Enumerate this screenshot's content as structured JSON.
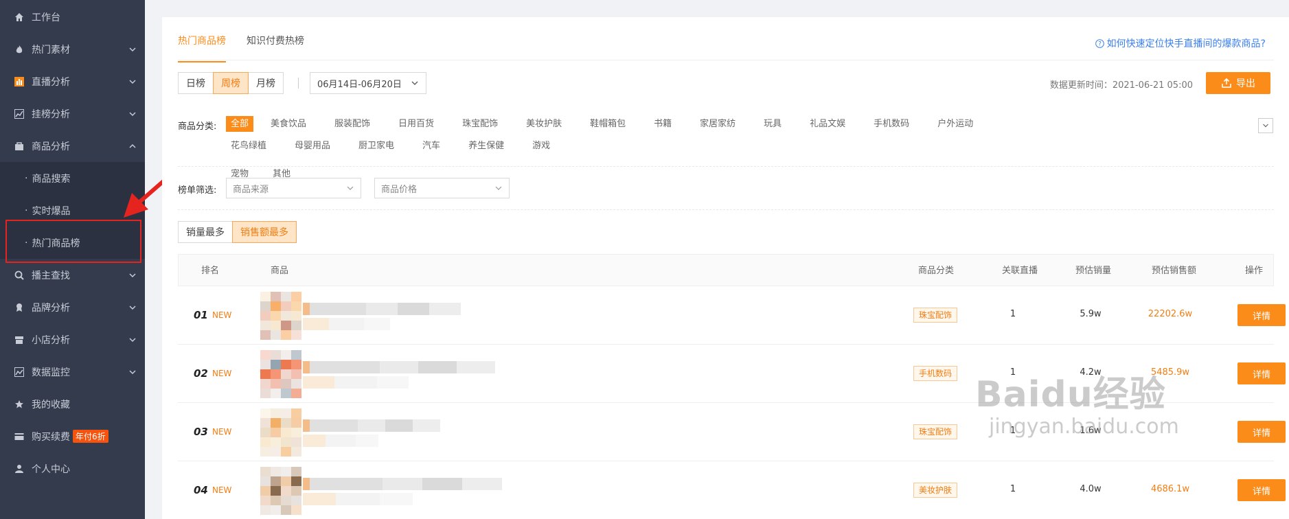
{
  "sidebar": {
    "items": [
      {
        "label": "工作台",
        "icon": "home-icon",
        "chevron": false
      },
      {
        "label": "热门素材",
        "icon": "fire-icon",
        "chevron": true
      },
      {
        "label": "直播分析",
        "icon": "bar-chart-icon",
        "chevron": true
      },
      {
        "label": "挂榜分析",
        "icon": "line-chart-icon",
        "chevron": true
      },
      {
        "label": "商品分析",
        "icon": "bag-icon",
        "chevron": true,
        "expanded": true
      }
    ],
    "sub_items": [
      "商品搜索",
      "实时爆品",
      "热门商品榜"
    ],
    "items_after": [
      {
        "label": "播主查找",
        "icon": "search-icon",
        "chevron": true
      },
      {
        "label": "品牌分析",
        "icon": "medal-icon",
        "chevron": true
      },
      {
        "label": "小店分析",
        "icon": "shop-icon",
        "chevron": true
      },
      {
        "label": "数据监控",
        "icon": "monitor-icon",
        "chevron": true
      },
      {
        "label": "我的收藏",
        "icon": "star-icon",
        "chevron": false
      },
      {
        "label": "购买续费",
        "icon": "card-icon",
        "chevron": false,
        "badge": "年付6折"
      },
      {
        "label": "个人中心",
        "icon": "user-icon",
        "chevron": false
      }
    ],
    "sub_dot": "·"
  },
  "tabs": [
    "热门商品榜",
    "知识付费热榜"
  ],
  "help_link": "如何快速定位快手直播间的爆款商品?",
  "period": {
    "options": [
      "日榜",
      "周榜",
      "月榜"
    ],
    "selected": "周榜"
  },
  "date_range": "06月14日-06月20日",
  "update_time": "数据更新时间：2021-06-21 05:00",
  "export_label": "导出",
  "category": {
    "label": "商品分类:",
    "row1": [
      "全部",
      "美食饮品",
      "服装配饰",
      "日用百货",
      "珠宝配饰",
      "美妆护肤",
      "鞋帽箱包",
      "书籍",
      "家居家纺",
      "玩具",
      "礼品文娱",
      "手机数码",
      "户外运动",
      "花鸟绿植",
      "母婴用品",
      "厨卫家电",
      "汽车",
      "养生保健",
      "游戏"
    ],
    "row2": [
      "宠物",
      "其他"
    ],
    "selected": "全部"
  },
  "filter": {
    "label": "榜单筛选:",
    "source_placeholder": "商品来源",
    "price_placeholder": "商品价格"
  },
  "sort": {
    "options": [
      "销量最多",
      "销售额最多"
    ],
    "selected": "销售额最多"
  },
  "table": {
    "headers": {
      "rank": "排名",
      "product": "商品",
      "category": "商品分类",
      "live": "关联直播",
      "sales": "预估销量",
      "revenue": "预估销售额",
      "action": "操作"
    },
    "rows": [
      {
        "rank": "01",
        "new": "NEW",
        "category": "珠宝配饰",
        "live": "1",
        "sales": "5.9w",
        "revenue": "22202.6w",
        "action": "详情"
      },
      {
        "rank": "02",
        "new": "NEW",
        "category": "手机数码",
        "live": "1",
        "sales": "4.2w",
        "revenue": "5485.9w",
        "action": "详情"
      },
      {
        "rank": "03",
        "new": "NEW",
        "category": "珠宝配饰",
        "live": "1",
        "sales": "1.6w",
        "revenue": "",
        "action": "详情"
      },
      {
        "rank": "04",
        "new": "NEW",
        "category": "美妆护肤",
        "live": "1",
        "sales": "4.0w",
        "revenue": "4686.1w",
        "action": "详情"
      }
    ]
  },
  "watermark": {
    "brand": "Baidu经验",
    "url": "jingyan.baidu.com"
  },
  "colors": {
    "accent": "#fb8c1a",
    "sidebar": "#343b4c",
    "highlight": "#e5231f"
  }
}
